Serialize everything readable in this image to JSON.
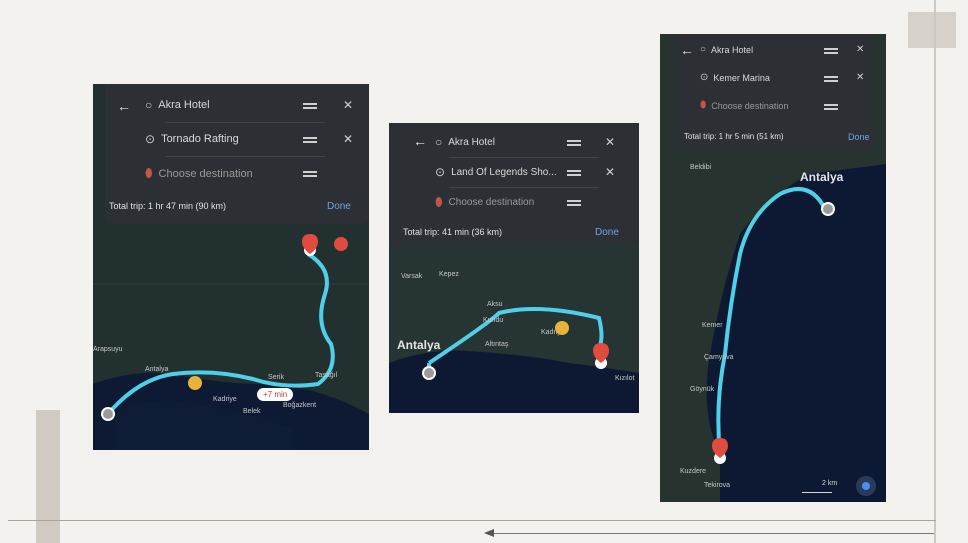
{
  "screens": [
    {
      "origin": "Akra Hotel",
      "stop": "Tornado Rafting",
      "destination_placeholder": "Choose destination",
      "total": "Total trip: 1 hr 47 min (90 km)",
      "done": "Done",
      "chip_time": "+7 min",
      "labels": [
        "Antalya",
        "Kadriye",
        "Belek",
        "Boğazkent",
        "Serik",
        "Taşağıl",
        "Arapsuyu"
      ]
    },
    {
      "origin": "Akra Hotel",
      "stop": "Land Of Legends Sho...",
      "destination_placeholder": "Choose destination",
      "total": "Total trip: 41 min (36 km)",
      "done": "Done",
      "labels": [
        "Antalya",
        "Varsak",
        "Kepez",
        "Kundu",
        "Aksu",
        "Kadriye",
        "Altıntaş",
        "Kızılot"
      ]
    },
    {
      "origin": "Akra Hotel",
      "stop": "Kemer Marina",
      "destination_placeholder": "Choose destination",
      "total": "Total trip: 1 hr 5 min (51 km)",
      "done": "Done",
      "labels": [
        "Antalya",
        "Kemer",
        "Göynük",
        "Beldibi",
        "Çamyuva",
        "Tekirova",
        "Kuzdere"
      ],
      "scale": "2 km"
    }
  ],
  "colors": {
    "route": "#4fd0e8",
    "pin": "#e04b3f",
    "panel": "#2c2f33",
    "map": "#12213a"
  },
  "icons": [
    "back-arrow-icon",
    "origin-circle-icon",
    "stop-icon",
    "destination-pin-icon",
    "drag-handle-icon",
    "close-icon",
    "my-location-icon"
  ]
}
